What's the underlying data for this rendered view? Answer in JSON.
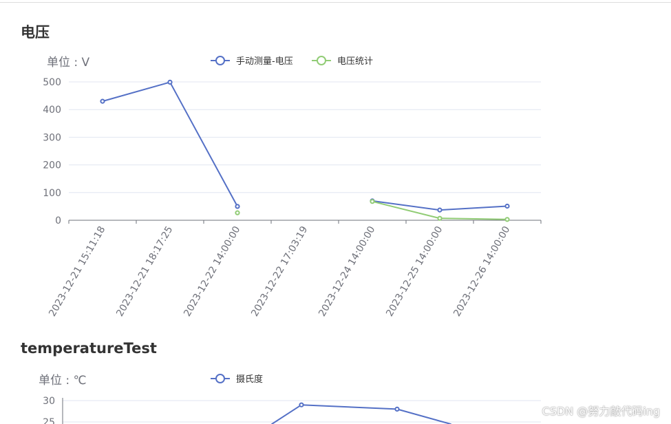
{
  "charts": [
    {
      "title": "电压",
      "unit_label": "单位 : V",
      "legend": [
        "手动测量-电压",
        "电压统计"
      ],
      "series_colors": [
        "#5470c6",
        "#91cc75"
      ]
    },
    {
      "title": "temperatureTest",
      "unit_label": "单位 : ℃",
      "legend": [
        "摄氏度"
      ],
      "series_colors": [
        "#5470c6"
      ]
    }
  ],
  "chart_data": [
    {
      "type": "line",
      "title": "电压",
      "ylabel": "单位 : V",
      "categories": [
        "2023-12-21 15:11:18",
        "2023-12-21 18:17:25",
        "2023-12-22 14:00:00",
        "2023-12-22 17:03:19",
        "2023-12-24 14:00:00",
        "2023-12-25 14:00:00",
        "2023-12-26 14:00:00"
      ],
      "series": [
        {
          "name": "手动测量-电压",
          "values": [
            430,
            499,
            50,
            null,
            70,
            37,
            51
          ]
        },
        {
          "name": "电压统计",
          "values": [
            null,
            null,
            27,
            null,
            68,
            7,
            3
          ]
        }
      ],
      "ylim": [
        0,
        500
      ],
      "yticks": [
        0,
        100,
        200,
        300,
        400,
        500
      ],
      "grid": true,
      "legend_position": "top-center"
    },
    {
      "type": "line",
      "title": "temperatureTest",
      "ylabel": "单位 : ℃",
      "series": [
        {
          "name": "摄氏度",
          "values": [
            null,
            null,
            null,
            24.5,
            29,
            null,
            28,
            24.5
          ]
        }
      ],
      "yticks": [
        25,
        30
      ],
      "grid": true,
      "legend_position": "top-center"
    }
  ],
  "watermark": "CSDN @努力敲代码ing"
}
